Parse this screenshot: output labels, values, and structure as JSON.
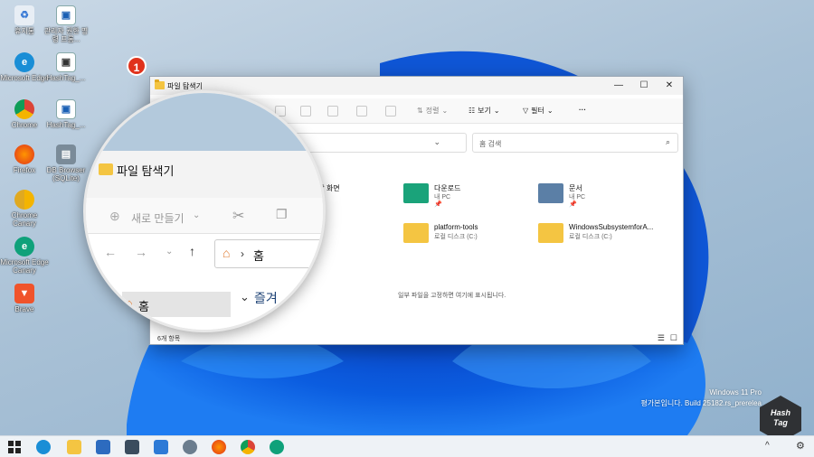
{
  "desktop": {
    "icons": [
      {
        "label": "휴지통",
        "icon": "recycle-bin-icon"
      },
      {
        "label": "Microsoft Edge",
        "icon": "edge-icon"
      },
      {
        "label": "Chrome",
        "icon": "chrome-icon"
      },
      {
        "label": "Firefox",
        "icon": "firefox-icon"
      },
      {
        "label": "Chrome Canary",
        "icon": "chrome-canary-icon"
      },
      {
        "label": "Microsoft Edge Canary",
        "icon": "edge-canary-icon"
      },
      {
        "label": "Brave",
        "icon": "brave-icon"
      },
      {
        "label": "관리자 권한 명령 프롬...",
        "icon": "shortcut-icon"
      },
      {
        "label": "HashTag_...",
        "icon": "shortcut-icon"
      },
      {
        "label": "HashTag_...",
        "icon": "shortcut-icon"
      },
      {
        "label": "DB Browser (SQLite)",
        "icon": "db-browser-icon"
      }
    ]
  },
  "badge": {
    "number": "1"
  },
  "explorer": {
    "title": "파일 탐색기",
    "controls": {
      "minimize": "—",
      "maximize": "☐",
      "close": "✕"
    },
    "toolbar": {
      "sort_label": "정렬",
      "view_label": "보기",
      "filter_label": "필터",
      "more_label": "···"
    },
    "search": {
      "placeholder": "홈 검색"
    },
    "quick_access": [
      {
        "name": "바탕 화면",
        "location": ""
      },
      {
        "name": "다운로드",
        "location": "내 PC",
        "color": "#1aa37a"
      },
      {
        "name": "문서",
        "location": "내 PC",
        "color": "#5b7fa6"
      },
      {
        "name": "platform-tools",
        "location": "로컬 디스크 (C:)",
        "color": "#f4c542"
      },
      {
        "name": "WindowsSubsystemforA...",
        "location": "로컬 디스크 (C:)",
        "color": "#f4c542"
      }
    ],
    "empty_message": "일부 파일을 고정하면 여기에 표시됩니다.",
    "status": "6개 항목"
  },
  "magnifier": {
    "title": "파일 탐색기",
    "new_label": "새로 만들기",
    "address_text": "홈",
    "nav_item": "홈",
    "section_label": "즐겨"
  },
  "watermark": {
    "line1": "Windows 11 Pro",
    "line2": "평가본입니다. Build 25182.rs_prerelea"
  },
  "logo": {
    "text_line1": "Hash",
    "text_line2": "Tag"
  },
  "colors": {
    "accent": "#0067c0",
    "badge": "#e0321c",
    "folder": "#f4c542"
  }
}
